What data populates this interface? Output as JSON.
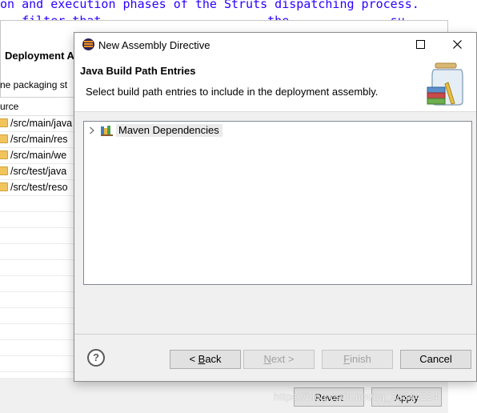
{
  "background": {
    "code_line1": "on and execution phases of the Struts dispatching process.",
    "code_line2": "   filter that  ...              ... the  ...         su",
    "window_title_fragment": "Deployment A",
    "subtitle_fragment": "ne packaging st",
    "column_header_fragment": "urce",
    "rows": [
      "/src/main/java",
      "/src/main/res",
      "/src/main/we",
      "/src/test/java",
      "/src/test/reso"
    ],
    "revert_label": "Revert",
    "apply_label": "Apply",
    "watermark": "https://blog.csdn.net/qq_38344214"
  },
  "dialog": {
    "title": "New Assembly Directive",
    "header_title": "Java Build Path Entries",
    "header_description": "Select build path entries to include in the deployment assembly.",
    "tree_items": [
      {
        "label": "Maven Dependencies",
        "icon": "library-icon",
        "expanded": false
      }
    ],
    "buttons": {
      "help": "?",
      "back_prefix": "< ",
      "back_mnemonic": "B",
      "back_rest": "ack",
      "next_mnemonic": "N",
      "next_rest": "ext >",
      "finish_mnemonic": "F",
      "finish_rest": "inish",
      "cancel": "Cancel"
    },
    "states": {
      "back": "enabled",
      "next": "disabled",
      "finish": "disabled",
      "cancel": "enabled"
    }
  },
  "colors": {
    "accent_code": "#2a00ff",
    "dialog_bg": "#f0f0f0",
    "tree_border": "#828790",
    "disabled_text": "#a0a0a0"
  }
}
